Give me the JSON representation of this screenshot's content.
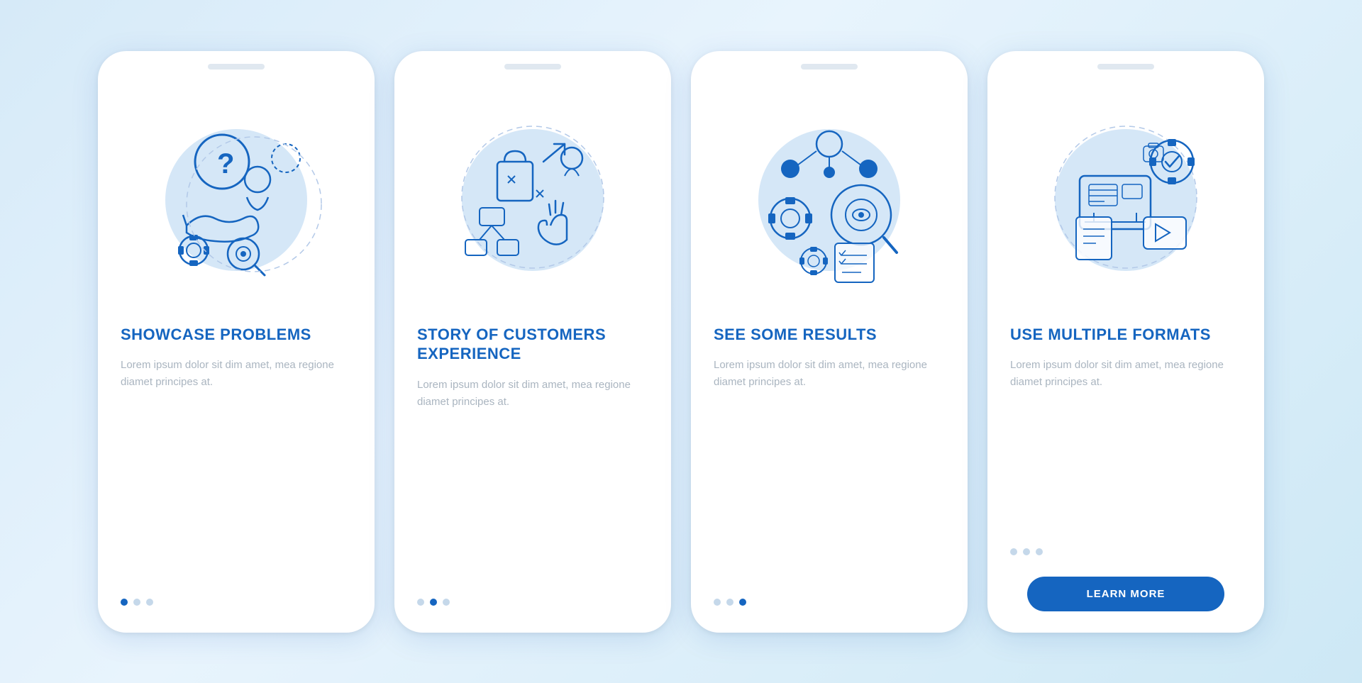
{
  "background": "#d6eaf8",
  "accent_color": "#1565c0",
  "cards": [
    {
      "id": "card-1",
      "title": "SHOWCASE PROBLEMS",
      "description": "Lorem ipsum dolor sit dim amet, mea regione diamet principes at.",
      "dots": [
        true,
        false,
        false
      ],
      "active_dot": 0,
      "has_button": false,
      "button_label": ""
    },
    {
      "id": "card-2",
      "title": "STORY OF CUSTOMERS EXPERIENCE",
      "description": "Lorem ipsum dolor sit dim amet, mea regione diamet principes at.",
      "dots": [
        false,
        true,
        false
      ],
      "active_dot": 1,
      "has_button": false,
      "button_label": ""
    },
    {
      "id": "card-3",
      "title": "SEE SOME RESULTS",
      "description": "Lorem ipsum dolor sit dim amet, mea regione diamet principes at.",
      "dots": [
        false,
        false,
        true
      ],
      "active_dot": 2,
      "has_button": false,
      "button_label": ""
    },
    {
      "id": "card-4",
      "title": "USE MULTIPLE FORMATS",
      "description": "Lorem ipsum dolor sit dim amet, mea regione diamet principes at.",
      "dots": [
        false,
        false,
        false
      ],
      "active_dot": -1,
      "has_button": true,
      "button_label": "LEARN MORE"
    }
  ]
}
